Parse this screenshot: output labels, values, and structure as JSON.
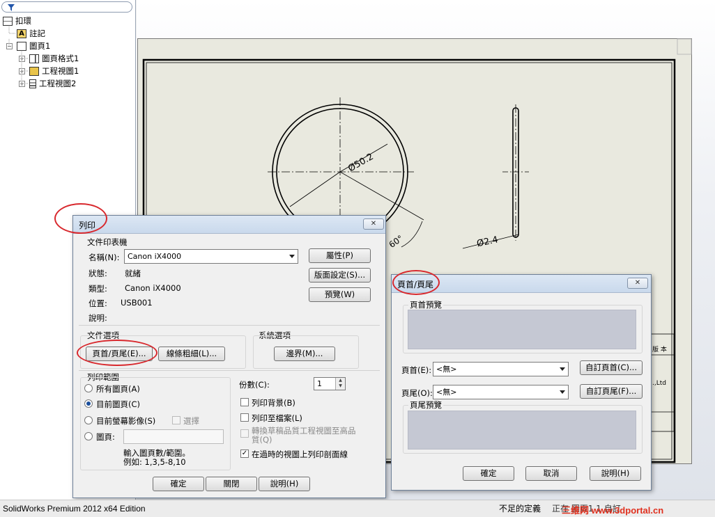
{
  "feature_tree": {
    "filter_icon": "filter-icon",
    "root": "扣環",
    "annotations": "註記",
    "sheet": "圖頁1",
    "sheet_format": "圖頁格式1",
    "view1": "工程視圖1",
    "view2": "工程視圖2"
  },
  "drawing": {
    "dim_diameter": "Ø50.2",
    "dim_angle": "60°",
    "dim_thickness": "Ø2.4",
    "title_text": "版 本",
    "title_partial": ".,Ltd"
  },
  "status_bar": {
    "app_text": "SolidWorks Premium 2012 x64 Edition",
    "state": "不足的定義",
    "extra": "正在   圖頁1   1   自訂",
    "watermark": "三维网 www.3dportal.cn"
  },
  "print_dialog": {
    "title": "列印",
    "close_icon": "close-icon",
    "printer_group": "文件印表機",
    "name_label": "名稱(N):",
    "printer_name": "Canon iX4000",
    "properties_btn": "屬性(P)",
    "page_setup_btn": "版面設定(S)...",
    "preview_btn": "預覽(W)",
    "status_label": "狀態:",
    "status_value": "就緒",
    "type_label": "類型:",
    "type_value": "Canon iX4000",
    "location_label": "位置:",
    "location_value": "USB001",
    "comment_label": "說明:",
    "doc_options": "文件選項",
    "header_footer_btn": "頁首/頁尾(E)...",
    "line_weights_btn": "線條粗細(L)...",
    "system_options": "系統選項",
    "margins_btn": "邊界(M)...",
    "print_range": "列印範圍",
    "all_sheets": "所有圖頁(A)",
    "current_sheet": "目前圖頁(C)",
    "current_screen": "目前螢幕影像(S)",
    "selection": "選擇",
    "sheets": "圖頁:",
    "sheets_hint_1": "輸入圖頁數/範圍。",
    "sheets_hint_2": "例如: 1,3,5-8,10",
    "copies_label": "份數(C):",
    "copies_value": "1",
    "print_background": "列印背景(B)",
    "print_to_file": "列印至檔案(L)",
    "convert_draft": "轉換草稿品質工程視圖至高品質(Q)",
    "cross_hatch": "在過時的視圖上列印剖面線",
    "ok": "確定",
    "close": "關閉",
    "help": "說明(H)"
  },
  "hf_dialog": {
    "title": "頁首/頁尾",
    "close_icon": "close-icon",
    "header_preview": "頁首預覽",
    "header_label": "頁首(E):",
    "header_value": "<無>",
    "custom_header": "自訂頁首(C)...",
    "footer_label": "頁尾(O):",
    "footer_value": "<無>",
    "custom_footer": "自訂頁尾(F)...",
    "footer_preview": "頁尾預覽",
    "ok": "確定",
    "cancel": "取消",
    "help": "說明(H)"
  },
  "colors": {
    "annotation_ring": "#d8282d",
    "sheet_background": "#e9e9df",
    "preview_fill": "#c5c8d3"
  }
}
